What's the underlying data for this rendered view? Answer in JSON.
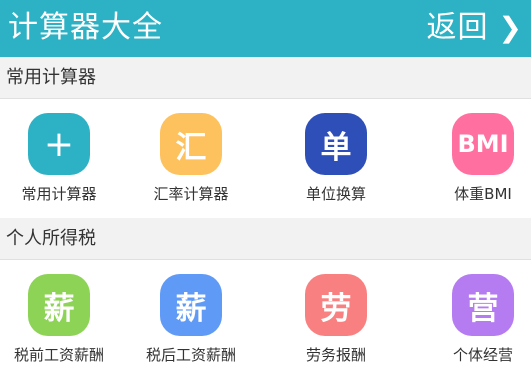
{
  "header": {
    "title": "计算器大全",
    "back_label": "返回",
    "back_icon": "chevron-right-icon",
    "bg_color": "#2db1c4"
  },
  "sections": [
    {
      "title": "常用计算器",
      "items": [
        {
          "glyph": "+",
          "label": "常用计算器",
          "color": "#2db1c4"
        },
        {
          "glyph": "汇",
          "label": "汇率计算器",
          "color": "#fdc15d"
        },
        {
          "glyph": "单",
          "label": "单位换算",
          "color": "#2f4fb8"
        },
        {
          "glyph": "BMI",
          "label": "体重BMI",
          "color": "#ff6fa0"
        }
      ]
    },
    {
      "title": "个人所得税",
      "items": [
        {
          "glyph": "薪",
          "label": "税前工资薪酬",
          "color": "#8cd356"
        },
        {
          "glyph": "薪",
          "label": "税后工资薪酬",
          "color": "#5f9bf6"
        },
        {
          "glyph": "劳",
          "label": "劳务报酬",
          "color": "#f98080"
        },
        {
          "glyph": "营",
          "label": "个体经营",
          "color": "#b57bf1"
        }
      ]
    }
  ]
}
